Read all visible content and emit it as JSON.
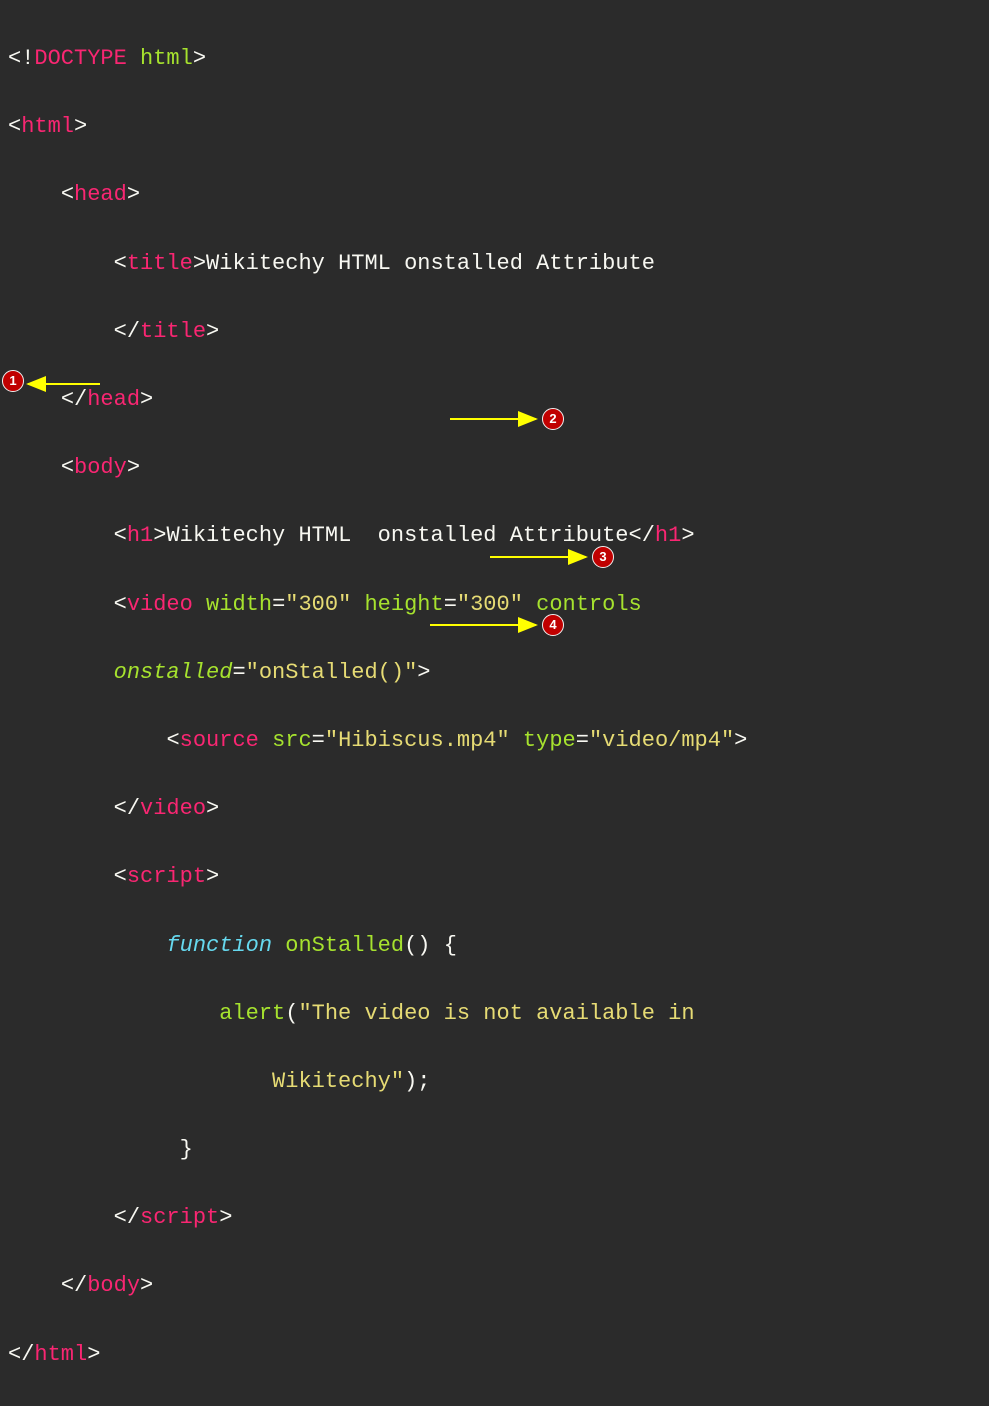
{
  "code": {
    "doctype_open": "<!",
    "doctype_name": "DOCTYPE",
    "doctype_rest": " html",
    "doctype_close": ">",
    "html_open": "html",
    "head_open": "head",
    "title_open": "title",
    "title_text": "Wikitechy HTML onstalled Attribute",
    "title_close": "title",
    "head_close": "head",
    "body_open": "body",
    "h1_open": "h1",
    "h1_text": "Wikitechy HTML  onstalled Attribute",
    "h1_close": "h1",
    "video_tag": "video",
    "attr_width": "width",
    "val_width": "\"300\"",
    "attr_height": "height",
    "val_height": "\"300\"",
    "attr_controls": "controls",
    "attr_onstalled": "onstalled",
    "val_onstalled": "\"onStalled()\"",
    "source_tag": "source",
    "attr_src": "src",
    "val_src": "\"Hibiscus.mp4\"",
    "attr_type": "type",
    "val_type": "\"video/mp4\"",
    "video_close": "video",
    "script_open": "script",
    "kw_function": "function",
    "fn_name": "onStalled",
    "fn_params": "()",
    "brace_open": "{",
    "alert_name": "alert",
    "alert_paren_open": "(",
    "alert_str1": "\"The video is not available in",
    "alert_str2": "Wikitechy\"",
    "alert_paren_close": ")",
    "semicolon": ";",
    "brace_close": "}",
    "script_close": "script",
    "body_close": "body",
    "html_close": "html"
  },
  "annotations": {
    "b1": "1",
    "b2": "2",
    "b3": "3",
    "b4": "4"
  }
}
